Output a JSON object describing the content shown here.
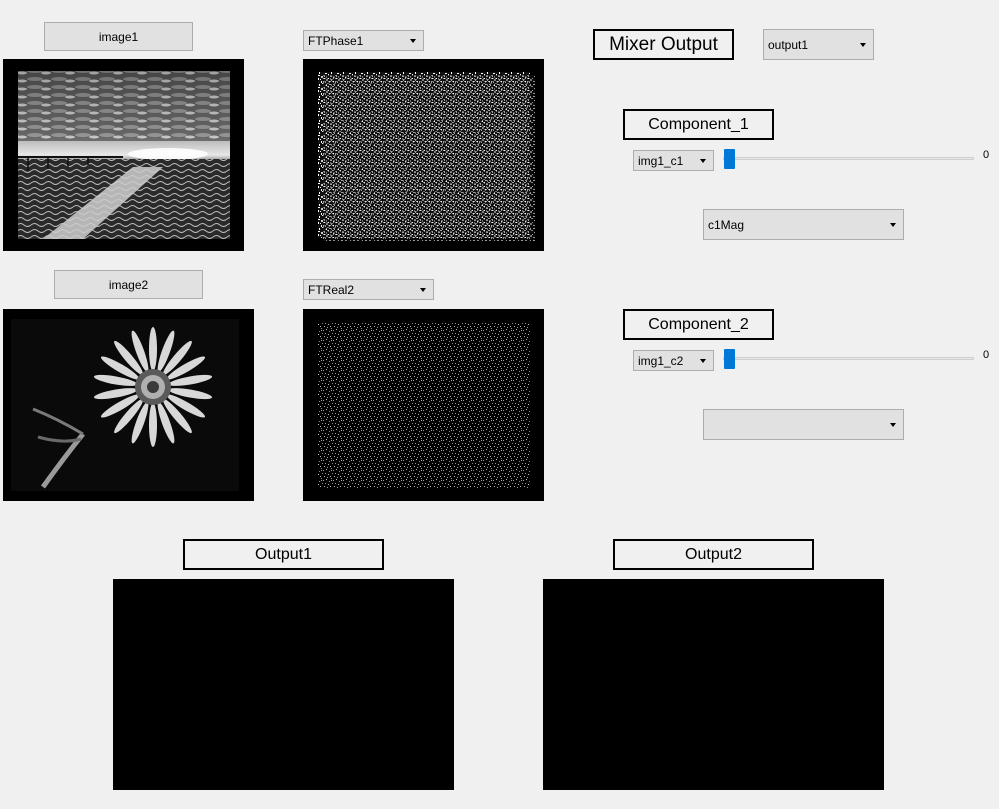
{
  "image1": {
    "button_label": "image1",
    "ft_selector": "FTPhase1"
  },
  "image2": {
    "button_label": "image2",
    "ft_selector": "FTReal2"
  },
  "mixer": {
    "title": "Mixer Output",
    "output_selector": "output1",
    "component1": {
      "title": "Component_1",
      "image_selector": "img1_c1",
      "slider_value": "0",
      "type_selector": "c1Mag"
    },
    "component2": {
      "title": "Component_2",
      "image_selector": "img1_c2",
      "slider_value": "0",
      "type_selector": ""
    }
  },
  "outputs": {
    "output1_label": "Output1",
    "output2_label": "Output2"
  },
  "colors": {
    "window_bg": "#f0f0f0",
    "slider_accent": "#0078d7",
    "frame": "#000000"
  }
}
